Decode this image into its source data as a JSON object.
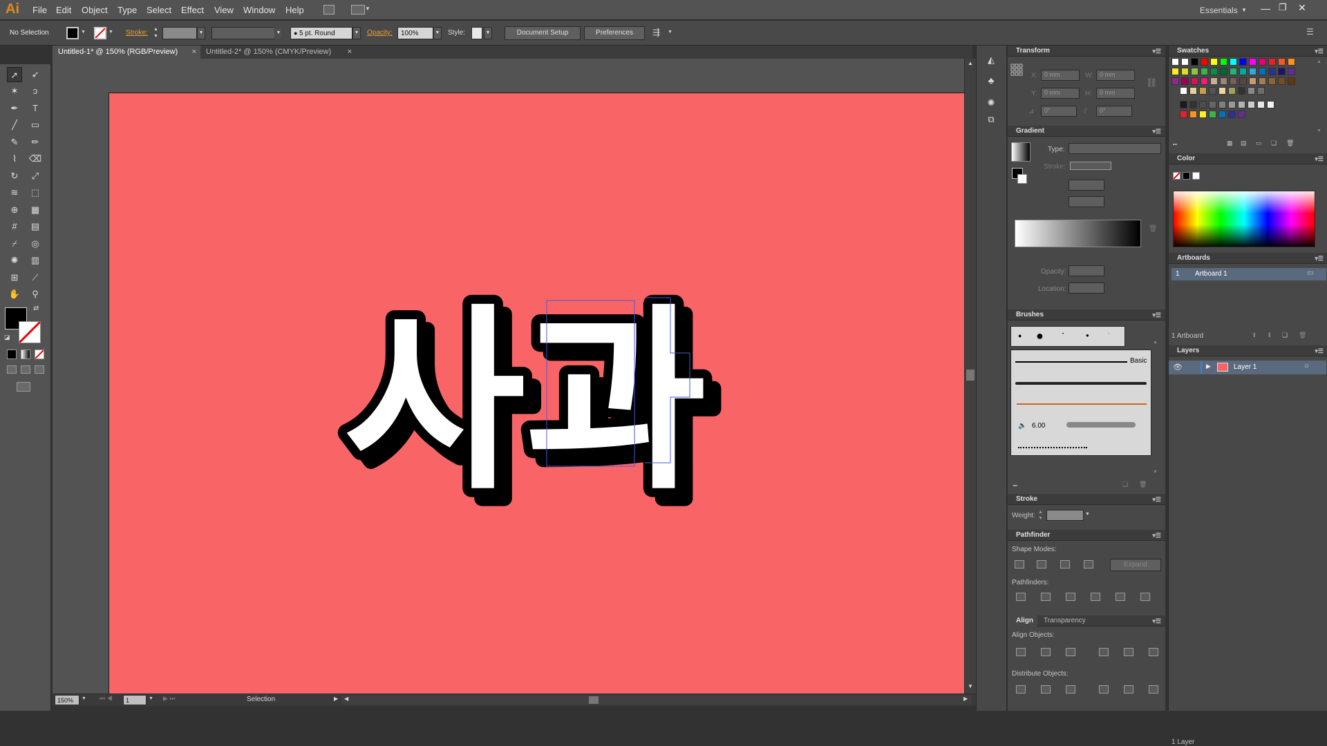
{
  "app": {
    "logo": "Ai",
    "workspace": "Essentials"
  },
  "menu": [
    "File",
    "Edit",
    "Object",
    "Type",
    "Select",
    "Effect",
    "View",
    "Window",
    "Help"
  ],
  "control": {
    "selection": "No Selection",
    "stroke_label": "Stroke:",
    "brush_label": "5 pt. Round",
    "opacity_label": "Opacity:",
    "opacity_value": "100%",
    "style_label": "Style:",
    "document_setup": "Document Setup",
    "preferences": "Preferences"
  },
  "tabs": [
    {
      "label": "Untitled-1* @ 150% (RGB/Preview)",
      "active": true
    },
    {
      "label": "Untitled-2* @ 150% (CMYK/Preview)",
      "active": false
    }
  ],
  "artwork": {
    "text": "사과",
    "artboard_color": "#f96567"
  },
  "status": {
    "zoom": "150%",
    "page": "1",
    "tool": "Selection"
  },
  "transform": {
    "title": "Transform",
    "x_label": "X:",
    "x": "0 mm",
    "y_label": "Y:",
    "y": "0 mm",
    "w_label": "W:",
    "w": "0 mm",
    "h_label": "H:",
    "h": "0 mm",
    "rotate": "0°",
    "shear": "0°"
  },
  "gradient": {
    "title": "Gradient",
    "type_label": "Type:",
    "stroke_label": "Stroke:",
    "opacity_label": "Opacity:",
    "location_label": "Location:"
  },
  "brushes": {
    "title": "Brushes",
    "basic": "Basic",
    "size": "6.00"
  },
  "stroke": {
    "title": "Stroke",
    "weight_label": "Weight:"
  },
  "pathfinder": {
    "title": "Pathfinder",
    "shape_modes": "Shape Modes:",
    "expand": "Expand",
    "pathfinders": "Pathfinders:"
  },
  "align": {
    "title": "Align",
    "transparency_tab": "Transparency",
    "align_objects": "Align Objects:",
    "distribute_objects": "Distribute Objects:"
  },
  "swatches": {
    "title": "Swatches"
  },
  "color": {
    "title": "Color"
  },
  "artboards": {
    "title": "Artboards",
    "items": [
      {
        "num": "1",
        "name": "Artboard 1"
      }
    ],
    "count": "1 Artboard"
  },
  "layers": {
    "title": "Layers",
    "items": [
      {
        "name": "Layer 1"
      }
    ],
    "count": "1 Layer"
  }
}
